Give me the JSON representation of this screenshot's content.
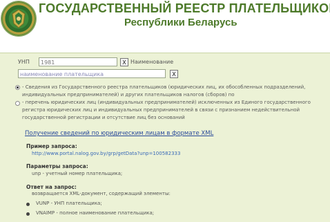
{
  "header": {
    "title": "ГОСУДАРСТВЕННЫЙ РЕЕСТР ПЛАТЕЛЬЩИКОВ",
    "subtitle": "Республики Беларусь",
    "emblem_icon": "customs-emblem-icon"
  },
  "search": {
    "unp_label": "УНП",
    "unp_value": "1981",
    "name_label": "Наименование",
    "name_value": "наименование плательщика",
    "clear_label": "X"
  },
  "options": [
    {
      "text": "- Сведения из Государственного реестра плательщиков (юридических лиц, их обособленных подразделений, индивидуальных предпринимателей) и других плательщиков налогов (сборов) по",
      "selected": true
    },
    {
      "text": "- перечень юридических лиц (индивидуальных предпринимателей) исключенных из Единого государственного регистра юридических лиц и индивидуальных предпринимателей в связи с признанием недействительной государственной регистрации и отсутствие лиц без оснований",
      "selected": false
    }
  ],
  "xml_section": {
    "title": "Получение сведений по юридическим лицам в формате XML",
    "example_heading": "Пример запроса:",
    "example_url": "http://www.portal.nalog.gov.by/grp/getData?unp=100582333",
    "params_heading": "Параметры запроса:",
    "params_text": "unp - учетный номер плательщика;",
    "response_heading": "Ответ на запрос:",
    "response_text": "возвращается XML-документ, содержащий элементы:",
    "elements": [
      "VUNP - УНП плательщика;",
      "VNAIMP - полное наименование плательщика;"
    ]
  },
  "colors": {
    "title": "#4d7a2a",
    "content_bg": "#ecf2d6",
    "link": "#2a4a9a"
  }
}
